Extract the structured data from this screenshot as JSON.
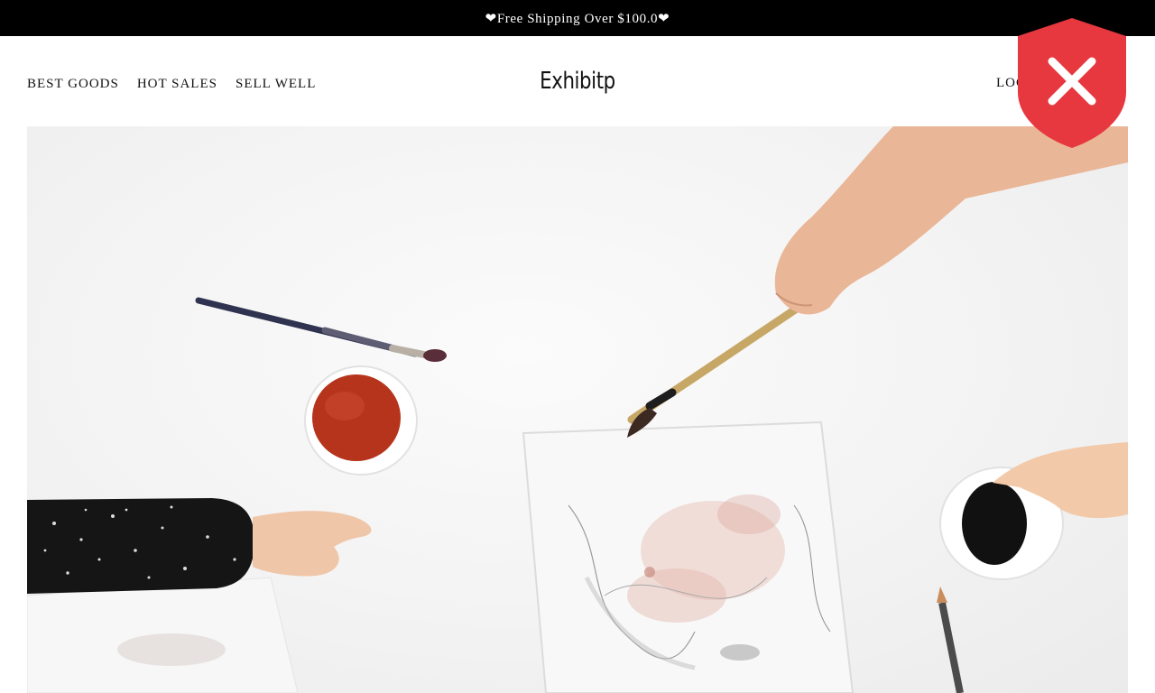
{
  "announcement": {
    "text": "❤Free Shipping Over $100.0❤"
  },
  "header": {
    "nav": [
      {
        "label": "BEST GOODS"
      },
      {
        "label": "HOT SALES"
      },
      {
        "label": "SELL WELL"
      }
    ],
    "brand": "Exhibitp",
    "login_label": "LOG"
  },
  "hero": {
    "icon": "hero-artwork-image"
  },
  "overlay": {
    "icon": "security-shield-x-icon",
    "color": "#e8383f"
  }
}
